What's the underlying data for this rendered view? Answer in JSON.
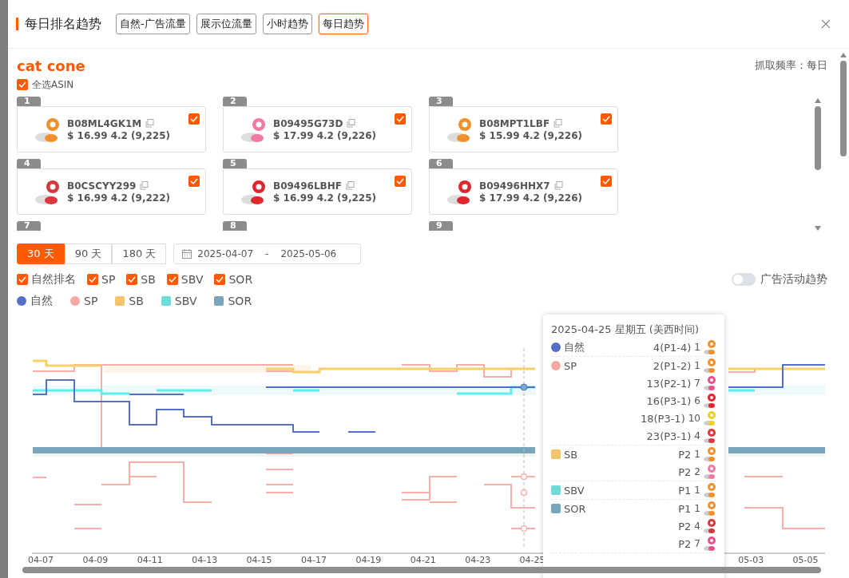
{
  "dialog": {
    "title": "每日排名趋势",
    "tabs": [
      {
        "label": "自然-广告流量",
        "selected": false
      },
      {
        "label": "展示位流量",
        "selected": false
      },
      {
        "label": "小时趋势",
        "selected": false
      },
      {
        "label": "每日趋势",
        "selected": true
      }
    ]
  },
  "keyword": "cat cone",
  "frequency": "抓取频率：每日",
  "select_all": {
    "label": "全选ASIN",
    "checked": true
  },
  "products": [
    {
      "number": "1",
      "asin": "B08ML4GK1M",
      "info": "$ 16.99 4.2 (9,225)",
      "checked": true,
      "color": "#f0902c"
    },
    {
      "number": "2",
      "asin": "B09495G73D",
      "info": "$ 17.99 4.2 (9,226)",
      "checked": true,
      "color": "#f07aa0"
    },
    {
      "number": "3",
      "asin": "B08MPT1LBF",
      "info": "$ 15.99 4.2 (9,226)",
      "checked": true,
      "color": "#f0902c"
    },
    {
      "number": "4",
      "asin": "B0CSCYY299",
      "info": "$ 16.99 4.2 (9,222)",
      "checked": true,
      "color": "#d9363e"
    },
    {
      "number": "5",
      "asin": "B09496LBHF",
      "info": "$ 16.99 4.2 (9,225)",
      "checked": true,
      "color": "#e0262e"
    },
    {
      "number": "6",
      "asin": "B09496HHX7",
      "info": "$ 17.99 4.2 (9,226)",
      "checked": true,
      "color": "#e0262e"
    }
  ],
  "partial_cards": [
    "7",
    "8",
    "9"
  ],
  "ranges": [
    {
      "label": "30 天",
      "selected": true
    },
    {
      "label": "90 天",
      "selected": false
    },
    {
      "label": "180 天",
      "selected": false
    }
  ],
  "date_range": {
    "start": "2025-04-07",
    "separator": "-",
    "end": "2025-05-06"
  },
  "filters": [
    {
      "label": "自然排名",
      "checked": true
    },
    {
      "label": "SP",
      "checked": true
    },
    {
      "label": "SB",
      "checked": true
    },
    {
      "label": "SBV",
      "checked": true
    },
    {
      "label": "SOR",
      "checked": true
    }
  ],
  "ad_trend_toggle": {
    "label": "广告活动趋势",
    "on": false
  },
  "legend": [
    {
      "label": "自然",
      "color": "#5470c6",
      "kind": "dot"
    },
    {
      "label": "SP",
      "color": "#f4aaa3",
      "kind": "dot"
    },
    {
      "label": "SB",
      "color": "#f2c46b",
      "kind": "square"
    },
    {
      "label": "SBV",
      "color": "#6cdcd8",
      "kind": "square"
    },
    {
      "label": "SOR",
      "color": "#7aa6bb",
      "kind": "square"
    }
  ],
  "chart": {
    "x_labels": [
      "04-07",
      "04-09",
      "04-11",
      "04-13",
      "04-15",
      "04-17",
      "04-19",
      "04-21",
      "04-23",
      "04-25",
      "05-03",
      "05-05"
    ]
  },
  "tooltip": {
    "title": "2025-04-25 星期五 (美西时间)",
    "groups": [
      {
        "name": "自然",
        "color": "#5470c6",
        "kind": "dot",
        "rows": [
          {
            "rank": "4(P1-4)",
            "index": "1",
            "color": "#f0902c"
          }
        ]
      },
      {
        "name": "SP",
        "color": "#f4aaa3",
        "kind": "dot",
        "rows": [
          {
            "rank": "2(P1-2)",
            "index": "1",
            "color": "#f0902c"
          },
          {
            "rank": "13(P2-1)",
            "index": "7",
            "color": "#e8508a"
          },
          {
            "rank": "16(P3-1)",
            "index": "6",
            "color": "#e0262e"
          },
          {
            "rank": "18(P3-1)",
            "index": "10",
            "color": "#e8d02a"
          },
          {
            "rank": "23(P3-1)",
            "index": "4",
            "color": "#d9363e"
          }
        ]
      },
      {
        "name": "SB",
        "color": "#f2c46b",
        "kind": "square",
        "rows": [
          {
            "rank": "P2",
            "index": "1",
            "color": "#f0902c"
          },
          {
            "rank": "P2",
            "index": "2",
            "color": "#f07aa0"
          }
        ]
      },
      {
        "name": "SBV",
        "color": "#6cdcd8",
        "kind": "square",
        "rows": [
          {
            "rank": "P1",
            "index": "1",
            "color": "#f0902c"
          }
        ]
      },
      {
        "name": "SOR",
        "color": "#7aa6bb",
        "kind": "square",
        "rows": [
          {
            "rank": "P1",
            "index": "1",
            "color": "#f0902c"
          },
          {
            "rank": "P2",
            "index": "4",
            "color": "#d9363e"
          },
          {
            "rank": "P2",
            "index": "7",
            "color": "#e8508a"
          }
        ]
      }
    ]
  }
}
